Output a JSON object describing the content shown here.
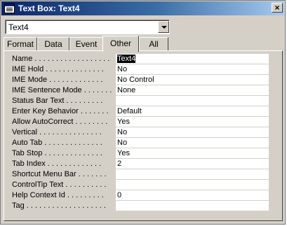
{
  "window": {
    "title": "Text Box: Text4",
    "close_label": "×"
  },
  "selector": {
    "value": "Text4"
  },
  "tabs": [
    {
      "label": "Format"
    },
    {
      "label": "Data"
    },
    {
      "label": "Event"
    },
    {
      "label": "Other"
    },
    {
      "label": "All"
    }
  ],
  "active_tab": "Other",
  "properties": [
    {
      "label": "Name . . . . . . . . . . . . . . . . . .",
      "value": "Text4"
    },
    {
      "label": "IME Hold . . . . . . . . . . . . . .",
      "value": "No"
    },
    {
      "label": "IME Mode . . . . . . . . . . . . .",
      "value": "No Control"
    },
    {
      "label": "IME Sentence Mode . . . . . . .",
      "value": "None"
    },
    {
      "label": "Status Bar Text . . . . . . . . .",
      "value": ""
    },
    {
      "label": "Enter Key Behavior . . . . . . .",
      "value": "Default"
    },
    {
      "label": "Allow AutoCorrect . . . . . . . .",
      "value": "Yes"
    },
    {
      "label": "Vertical . . . . . . . . . . . . . . .",
      "value": "No"
    },
    {
      "label": "Auto Tab . . . . . . . . . . . . . .",
      "value": "No"
    },
    {
      "label": "Tab Stop . . . . . . . . . . . . . .",
      "value": "Yes"
    },
    {
      "label": "Tab Index . . . . . . . . . . . . .",
      "value": "2"
    },
    {
      "label": "Shortcut Menu Bar . . . . . . .",
      "value": ""
    },
    {
      "label": "ControlTip Text . . . . . . . . . .",
      "value": ""
    },
    {
      "label": "Help Context Id . . . . . . . . .",
      "value": "0"
    },
    {
      "label": "Tag . . . . . . . . . . . . . . . . . . .",
      "value": ""
    }
  ]
}
